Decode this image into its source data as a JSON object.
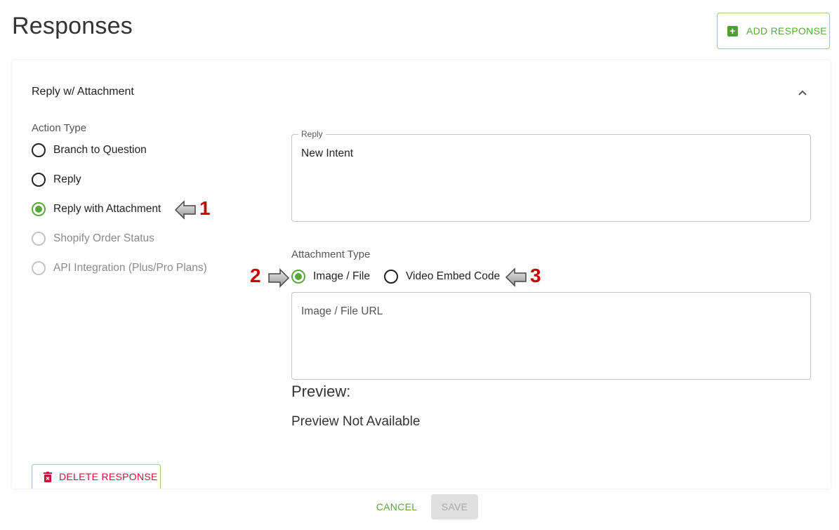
{
  "page": {
    "title": "Responses",
    "add_response_label": "ADD RESPONSE"
  },
  "card": {
    "title": "Reply w/ Attachment",
    "action_type": {
      "label": "Action Type",
      "selected": "Reply with Attachment",
      "options": [
        {
          "label": "Branch to Question",
          "state": "unchecked"
        },
        {
          "label": "Reply",
          "state": "unchecked"
        },
        {
          "label": "Reply with Attachment",
          "state": "checked"
        },
        {
          "label": "Shopify Order Status",
          "state": "disabled"
        },
        {
          "label": "API Integration (Plus/Pro Plans)",
          "state": "disabled"
        }
      ]
    },
    "reply": {
      "label": "Reply",
      "value": "New Intent"
    },
    "attachment_type": {
      "label": "Attachment Type",
      "selected": "Image / File",
      "options": [
        {
          "label": "Image / File",
          "state": "checked"
        },
        {
          "label": "Video Embed Code",
          "state": "unchecked"
        }
      ]
    },
    "url_field": {
      "placeholder": "Image / File URL",
      "value": ""
    },
    "preview": {
      "heading": "Preview:",
      "text": "Preview Not Available"
    },
    "delete_label": "DELETE RESPONSE"
  },
  "footer": {
    "cancel_label": "CANCEL",
    "save_label": "SAVE"
  },
  "annotations": {
    "one": "1",
    "two": "2",
    "three": "3"
  },
  "colors": {
    "accent": "#5aa83a",
    "danger": "#d0103a",
    "annotation": "#cc0000"
  }
}
